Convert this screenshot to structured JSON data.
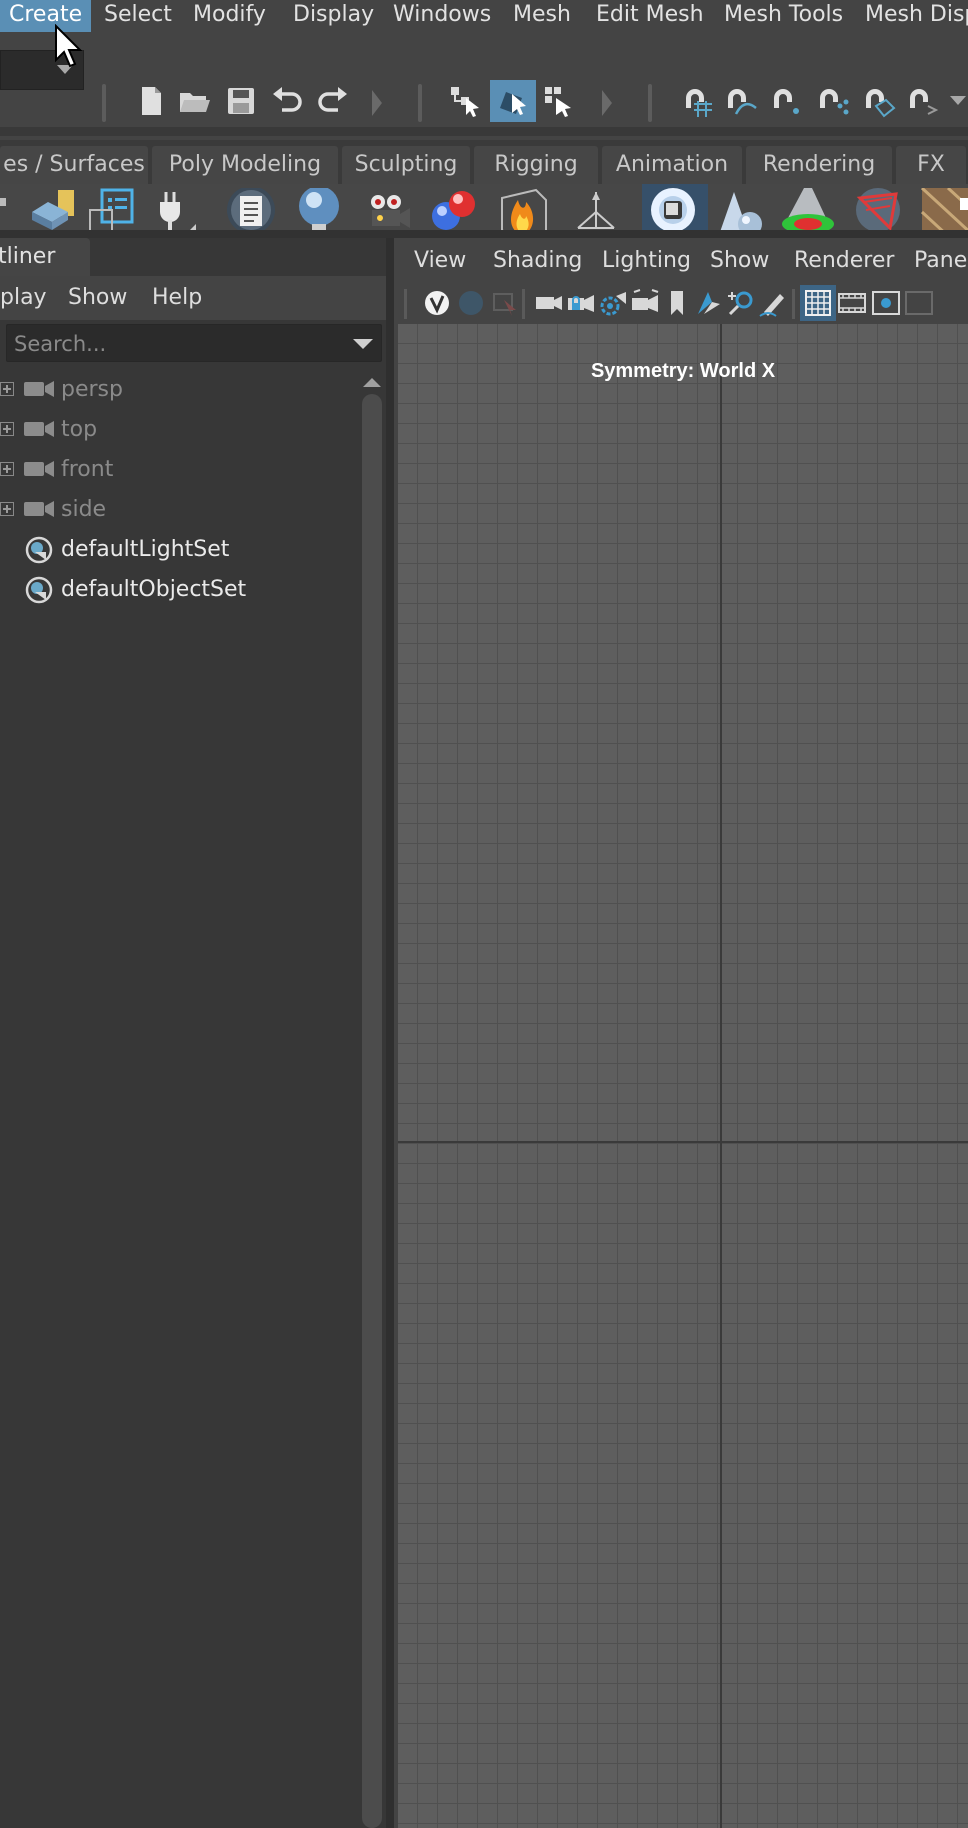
{
  "menubar": {
    "items": [
      "Create",
      "Select",
      "Modify",
      "Display",
      "Windows",
      "Mesh",
      "Edit Mesh",
      "Mesh Tools",
      "Mesh Disp"
    ],
    "active_item": "Create"
  },
  "shelf": {
    "tabs": [
      "es / Surfaces",
      "Poly Modeling",
      "Sculpting",
      "Rigging",
      "Animation",
      "Rendering",
      "FX"
    ],
    "active_icon": "light-sphere-icon"
  },
  "outliner": {
    "tab_label": "tliner",
    "menu": [
      "play",
      "Show",
      "Help"
    ],
    "search_placeholder": "Search...",
    "items": [
      {
        "label": "persp",
        "icon": "camera-icon",
        "state": "dim"
      },
      {
        "label": "top",
        "icon": "camera-icon",
        "state": "dim"
      },
      {
        "label": "front",
        "icon": "camera-icon",
        "state": "dim"
      },
      {
        "label": "side",
        "icon": "camera-icon",
        "state": "dim"
      },
      {
        "label": "defaultLightSet",
        "icon": "set-icon",
        "state": "bright"
      },
      {
        "label": "defaultObjectSet",
        "icon": "set-icon",
        "state": "bright"
      }
    ]
  },
  "viewport": {
    "menu": [
      "View",
      "Shading",
      "Lighting",
      "Show",
      "Renderer",
      "Panels"
    ],
    "overlay_text": "Symmetry: World X"
  },
  "colors": {
    "ui_background": "#444444",
    "menu_highlight": "#5a8fb5",
    "outliner_background": "#373737",
    "grid_fill": "#5e5e5e",
    "grid_line": "#505050",
    "active_toggle": "#3d6585"
  }
}
